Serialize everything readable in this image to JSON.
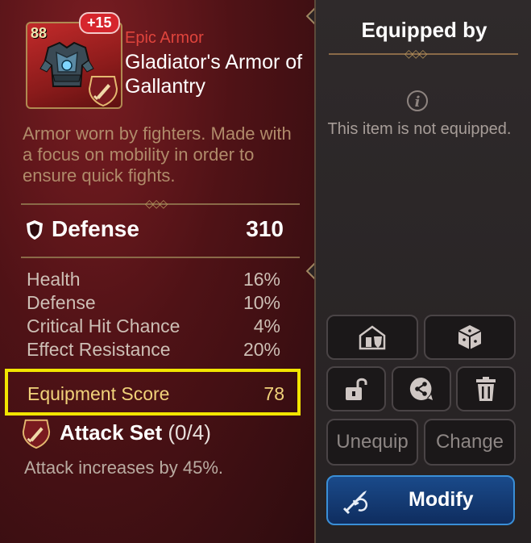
{
  "item": {
    "level": "88",
    "enhance": "+15",
    "rarity": "Epic Armor",
    "name": "Gladiator's Armor of Gallantry",
    "description": "Armor worn by fighters. Made with a focus on mobility in order to ensure quick fights."
  },
  "main_stat": {
    "name": "Defense",
    "value": "310"
  },
  "sub_stats": [
    {
      "name": "Health",
      "value": "16%"
    },
    {
      "name": "Defense",
      "value": "10%"
    },
    {
      "name": "Critical Hit Chance",
      "value": "4%"
    },
    {
      "name": "Effect Resistance",
      "value": "20%"
    }
  ],
  "score": {
    "label": "Equipment Score",
    "value": "78"
  },
  "set": {
    "name": "Attack Set",
    "count": "(0/4)",
    "description": "Attack increases by 45%."
  },
  "equipped_panel": {
    "title": "Equipped by",
    "status": "This item is not equipped."
  },
  "buttons": {
    "unequip": "Unequip",
    "change": "Change",
    "modify": "Modify"
  },
  "icons": {
    "storage": "storage-icon",
    "dice": "dice-icon",
    "lock": "unlock-icon",
    "share": "share-icon",
    "trash": "trash-icon",
    "modify": "modify-icon"
  },
  "colors": {
    "rarity": "#e0443c",
    "highlight_box": "#f2e500",
    "score_text": "#f1d27a",
    "modify_button": "#1a4a8a"
  }
}
